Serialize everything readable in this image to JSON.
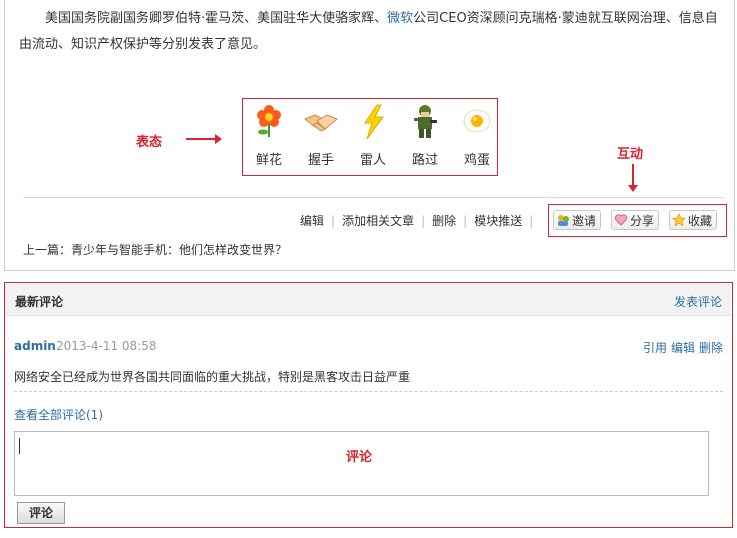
{
  "article": {
    "text_before_link": "美国国务院副国务卿罗伯特·霍马茨、美国驻华大使骆家辉、",
    "link_text": "微软",
    "text_after_link": "公司CEO资深顾问克瑞格·蒙迪就互联网治理、信息自由流动、知识产权保护等分别发表了意见。"
  },
  "annotations": {
    "reactions_label": "表态",
    "interaction_label": "互动",
    "comment_label": "评论"
  },
  "reactions": [
    {
      "icon": "flower-icon",
      "label": "鲜花"
    },
    {
      "icon": "handshake-icon",
      "label": "握手"
    },
    {
      "icon": "lightning-icon",
      "label": "雷人"
    },
    {
      "icon": "soldier-icon",
      "label": "路过"
    },
    {
      "icon": "egg-icon",
      "label": "鸡蛋"
    }
  ],
  "admin_actions": [
    "编辑",
    "添加相关文章",
    "删除",
    "模块推送"
  ],
  "share_buttons": [
    {
      "icon": "invite-icon",
      "label": "邀请"
    },
    {
      "icon": "heart-icon",
      "label": "分享"
    },
    {
      "icon": "star-icon",
      "label": "收藏"
    }
  ],
  "prev_article": "上一篇：青少年与智能手机：他们怎样改变世界？",
  "comments": {
    "title": "最新评论",
    "post_link": "发表评论",
    "items": [
      {
        "author": "admin",
        "time": "2013-4-11 08:58",
        "ops": [
          "引用",
          "编辑",
          "删除"
        ],
        "body": "网络安全已经成为世界各国共同面临的重大挑战，特别是黑客攻击日益严重"
      }
    ],
    "view_all": "查看全部评论(1)",
    "submit_label": "评论"
  },
  "colors": {
    "accent_red": "#d9232e",
    "link_blue": "#2b6ea8"
  }
}
